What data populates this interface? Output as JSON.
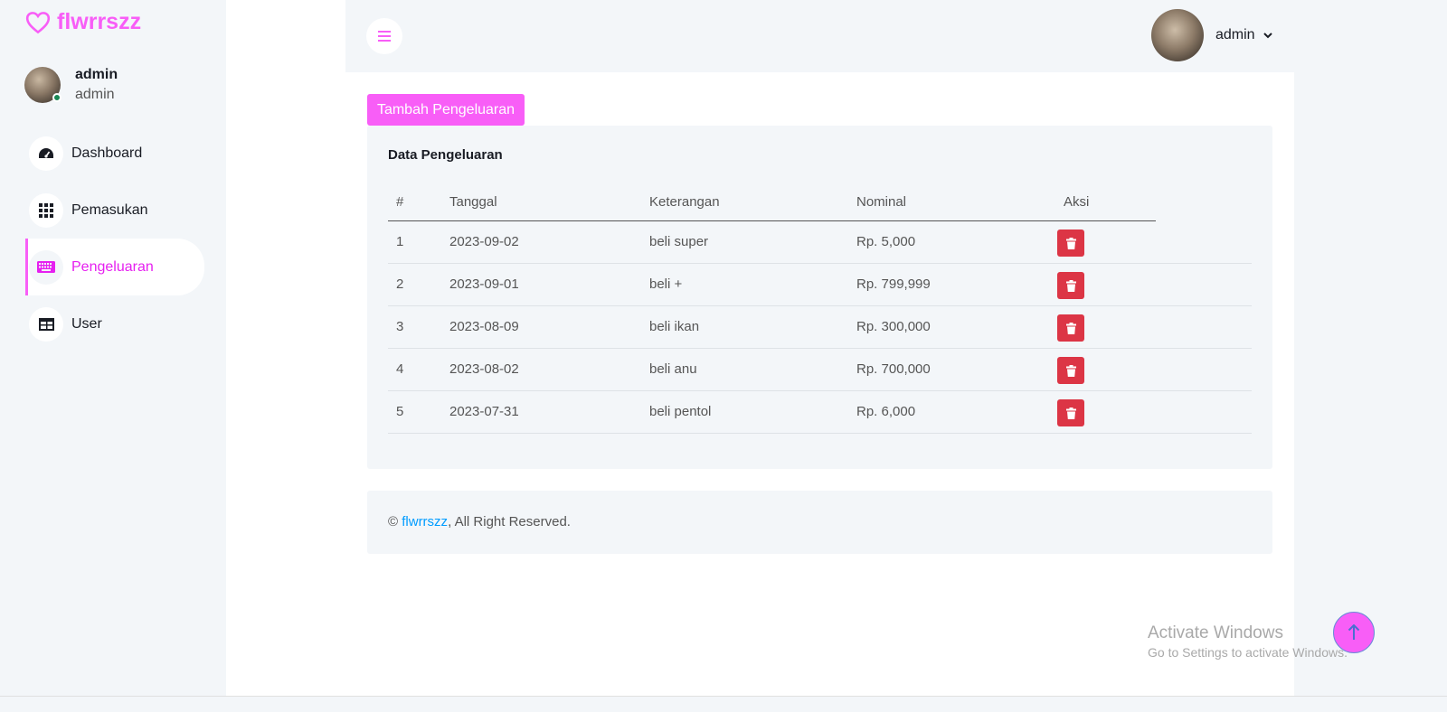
{
  "brand": {
    "name": "flwrrszz",
    "icon": "heart-outline-icon"
  },
  "profile": {
    "name": "admin",
    "role": "admin",
    "status_color": "#198754"
  },
  "sidebar": {
    "items": [
      {
        "label": "Dashboard",
        "icon": "tachometer-icon",
        "active": false
      },
      {
        "label": "Pemasukan",
        "icon": "grid-icon",
        "active": false
      },
      {
        "label": "Pengeluaran",
        "icon": "keyboard-icon",
        "active": true
      },
      {
        "label": "User",
        "icon": "table-icon",
        "active": false
      }
    ]
  },
  "topbar": {
    "toggle_icon": "hamburger-icon",
    "user_name": "admin"
  },
  "actions": {
    "add_label": "Tambah Pengeluaran"
  },
  "card": {
    "title": "Data Pengeluaran",
    "columns": [
      "#",
      "Tanggal",
      "Keterangan",
      "Nominal",
      "Aksi"
    ],
    "rows": [
      {
        "no": "1",
        "tanggal": "2023-09-02",
        "keterangan": "beli super",
        "nominal": "Rp. 5,000"
      },
      {
        "no": "2",
        "tanggal": "2023-09-01",
        "keterangan": "beli +",
        "nominal": "Rp. 799,999"
      },
      {
        "no": "3",
        "tanggal": "2023-08-09",
        "keterangan": "beli ikan",
        "nominal": "Rp. 300,000"
      },
      {
        "no": "4",
        "tanggal": "2023-08-02",
        "keterangan": "beli anu",
        "nominal": "Rp. 700,000"
      },
      {
        "no": "5",
        "tanggal": "2023-07-31",
        "keterangan": "beli pentol",
        "nominal": "Rp. 6,000"
      }
    ]
  },
  "footer": {
    "copy": "©",
    "brand_link": "flwrrszz",
    "suffix": ", All Right Reserved."
  },
  "watermark": {
    "line1": "Activate Windows",
    "line2": "Go to Settings to activate Windows."
  },
  "colors": {
    "accent": "#f85ef7",
    "active_text": "#e620f0",
    "danger": "#dc3545",
    "link": "#009cff",
    "panel": "#f3f6f9"
  }
}
